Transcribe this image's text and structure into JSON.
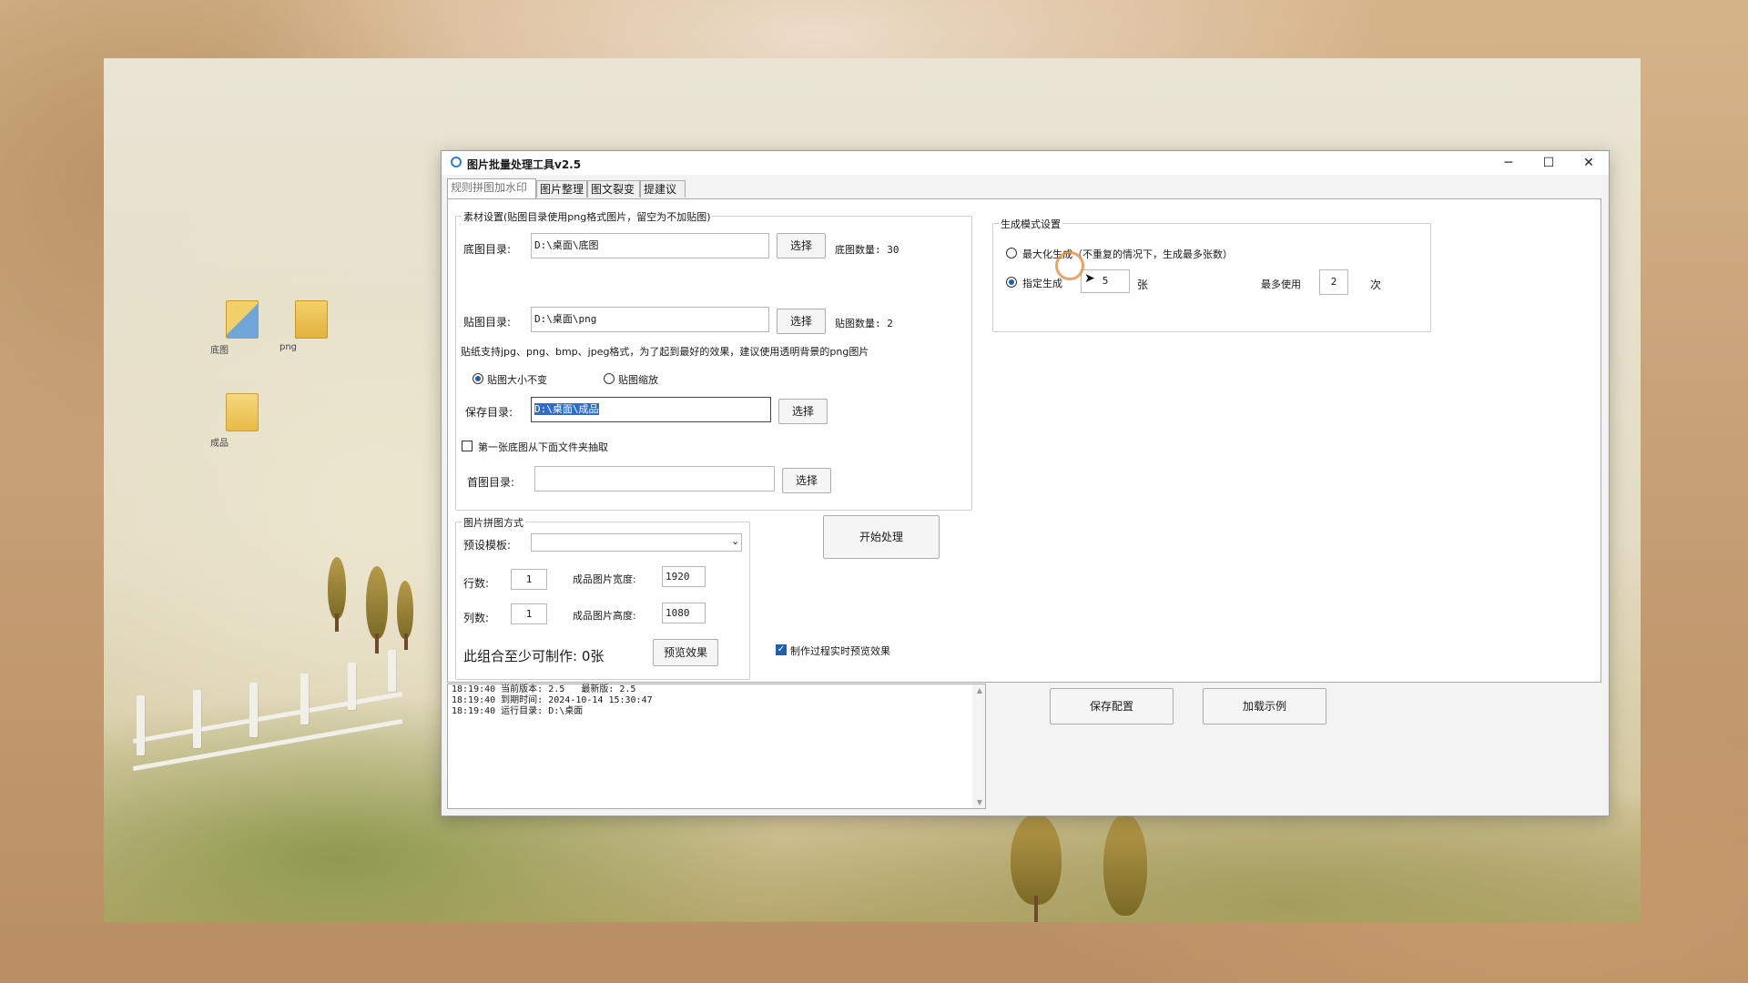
{
  "desktop": {
    "icons": [
      {
        "label": "底图",
        "icon": "image-folder-icon"
      },
      {
        "label": "png",
        "icon": "image-folder-icon"
      },
      {
        "label": "成品",
        "icon": "folder-icon"
      }
    ]
  },
  "window": {
    "title": "图片批量处理工具v2.5",
    "controls": {
      "minimize": "─",
      "maximize": "☐",
      "close": "✕"
    }
  },
  "tabs": [
    "规则拼图加水印",
    "图片整理",
    "图文裂变",
    "提建议"
  ],
  "material": {
    "group_title": "素材设置(贴图目录使用png格式图片，留空为不加贴图)",
    "base_dir_label": "底图目录:",
    "base_dir_value": "D:\\桌面\\底图",
    "base_select": "选择",
    "base_count": "底图数量: 30",
    "sticker_dir_label": "贴图目录:",
    "sticker_dir_value": "D:\\桌面\\png",
    "sticker_select": "选择",
    "sticker_count": "贴图数量: 2",
    "sticker_note": "贴纸支持jpg、png、bmp、jpeg格式，为了起到最好的效果，建议使用透明背景的png图片",
    "radio_keep": "贴图大小不变",
    "radio_scale": "贴图缩放",
    "save_dir_label": "保存目录:",
    "save_dir_value": "D:\\桌面\\成品",
    "save_select": "选择",
    "first_check": "第一张底图从下面文件夹抽取",
    "first_dir_label": "首图目录:",
    "first_dir_value": "",
    "first_select": "选择"
  },
  "collage": {
    "group_title": "图片拼图方式",
    "template_label": "预设模板:",
    "template_value": "",
    "rows_label": "行数:",
    "rows_value": "1",
    "cols_label": "列数:",
    "cols_value": "1",
    "width_label": "成品图片宽度:",
    "width_value": "1920",
    "height_label": "成品图片高度:",
    "height_value": "1080",
    "min_count": "此组合至少可制作: 0张",
    "preview_button": "预览效果"
  },
  "start_button": "开始处理",
  "realtime_preview": "制作过程实时预览效果",
  "mode": {
    "group_title": "生成模式设置",
    "max_label": "最大化生成（不重复的情况下，生成最多张数）",
    "specify_label": "指定生成",
    "specify_value": "5",
    "unit": "张",
    "max_use_label": "最多使用",
    "max_use_value": "2",
    "times": "次"
  },
  "log": {
    "lines": [
      "18:19:40 当前版本: 2.5   最新版: 2.5",
      "18:19:40 到期时间: 2024-10-14 15:30:47",
      "18:19:40 运行目录: D:\\桌面"
    ]
  },
  "bottom": {
    "save_config": "保存配置",
    "load_example": "加载示例"
  },
  "colors": {
    "accent": "#1f5fb0",
    "selection": "#2d6bd2"
  }
}
